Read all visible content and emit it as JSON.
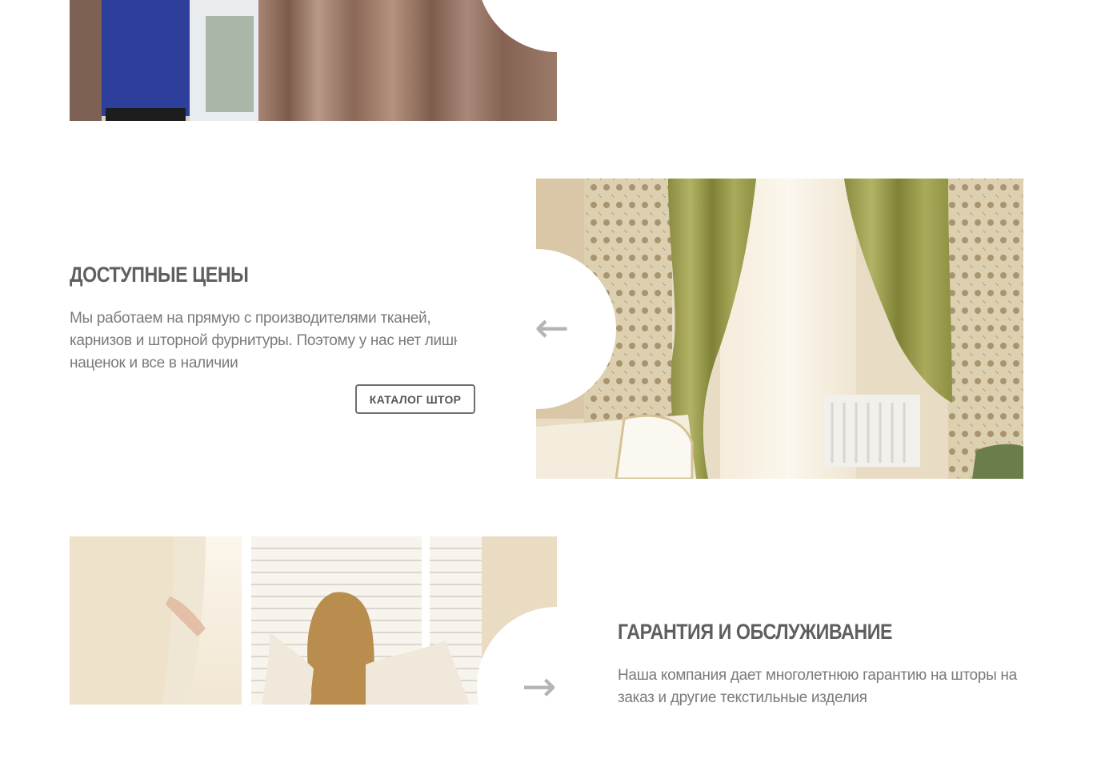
{
  "sections": [
    {
      "image": "photo-man-adjusting-curtain",
      "arrow": null
    },
    {
      "title": "ДОСТУПНЫЕ ЦЕНЫ",
      "text": "Мы работаем на прямую с производителями тканей, карнизов и шторной фурнитуры. Поэтому у нас нет лишних наценок и все в наличии",
      "button": "КАТАЛОГ ШТОР",
      "image": "photo-green-curtains-room",
      "arrow": "←"
    },
    {
      "title": "ГАРАНТИЯ И ОБСЛУЖИВАНИЕ",
      "text": "Наша компания дает многолетнюю гарантию на шторы на заказ и другие текстильные изделия",
      "image": "photo-woman-opening-curtains",
      "arrow": "→"
    }
  ],
  "colors": {
    "heading": "#5f5f5f",
    "text": "#7a7a7a",
    "arrow": "#b4b4b4",
    "button_border": "#6f6f6f"
  }
}
